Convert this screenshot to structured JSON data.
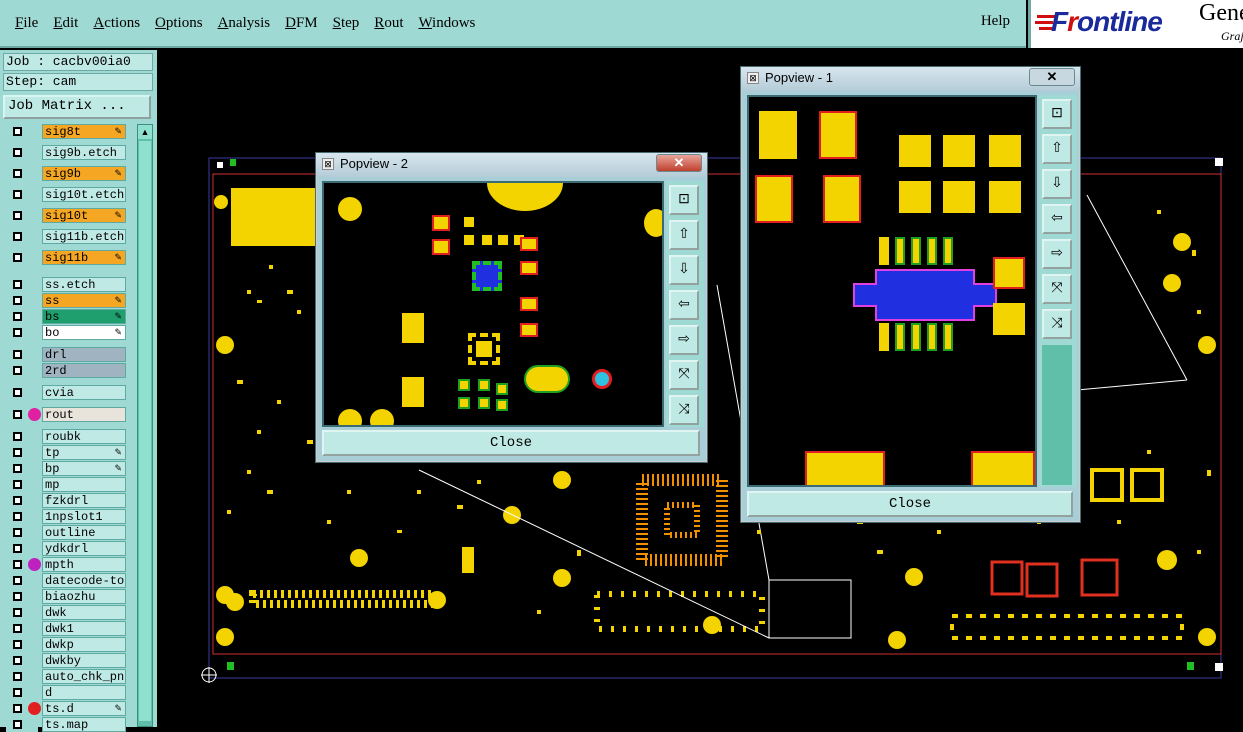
{
  "menu": {
    "items": [
      "File",
      "Edit",
      "Actions",
      "Options",
      "Analysis",
      "DFM",
      "Step",
      "Rout",
      "Windows"
    ],
    "help": "Help"
  },
  "logo": {
    "brand_a": "F",
    "brand_b": "r",
    "brand_c": "ontline",
    "sub": "Gene",
    "sub2": "Graj"
  },
  "info": {
    "job": "Job : cacbv00ia0",
    "step": "Step: cam",
    "job_matrix": "Job Matrix ..."
  },
  "layers": [
    {
      "name": "sig8t",
      "color": "#f5a623",
      "pen": true
    },
    {
      "name": "sig9b.etch",
      "color": "#bfe9e4",
      "pen": false
    },
    {
      "name": "sig9b",
      "color": "#f5a623",
      "pen": true
    },
    {
      "name": "sig10t.etch",
      "color": "#bfe9e4",
      "pen": false
    },
    {
      "name": "sig10t",
      "color": "#f5a623",
      "pen": true
    },
    {
      "name": "sig11b.etch",
      "color": "#bfe9e4",
      "pen": false
    },
    {
      "name": "sig11b",
      "color": "#f5a623",
      "pen": true
    },
    {
      "name": "ss.etch",
      "color": "#bfe9e4",
      "pen": false
    },
    {
      "name": "ss",
      "color": "#f5a623",
      "pen": true
    },
    {
      "name": "bs",
      "color": "#1f9e6e",
      "pen": true
    },
    {
      "name": "bo",
      "color": "#ffffff",
      "pen": true
    },
    {
      "name": "drl",
      "color": "#9fb4c0",
      "pen": false
    },
    {
      "name": "2rd",
      "color": "#9fb4c0",
      "pen": false
    },
    {
      "name": "cvia",
      "color": "#bfe9e4",
      "pen": false
    },
    {
      "name": "rout",
      "color": "#e8e4dc",
      "pen": false,
      "dot": "#e020a0"
    },
    {
      "name": "roubk",
      "color": "#bfe9e4",
      "pen": false
    },
    {
      "name": "tp",
      "color": "#bfe9e4",
      "pen": true
    },
    {
      "name": "bp",
      "color": "#bfe9e4",
      "pen": true
    },
    {
      "name": "mp",
      "color": "#bfe9e4",
      "pen": false
    },
    {
      "name": "fzkdrl",
      "color": "#bfe9e4",
      "pen": false
    },
    {
      "name": "1npslot1",
      "color": "#bfe9e4",
      "pen": false
    },
    {
      "name": "outline",
      "color": "#bfe9e4",
      "pen": false
    },
    {
      "name": "ydkdrl",
      "color": "#bfe9e4",
      "pen": false
    },
    {
      "name": "mpth",
      "color": "#bfe9e4",
      "pen": false,
      "dot": "#c020c0"
    },
    {
      "name": "datecode-to",
      "color": "#bfe9e4",
      "pen": false
    },
    {
      "name": "biaozhu",
      "color": "#bfe9e4",
      "pen": false
    },
    {
      "name": "dwk",
      "color": "#bfe9e4",
      "pen": false
    },
    {
      "name": "dwk1",
      "color": "#bfe9e4",
      "pen": false
    },
    {
      "name": "dwkp",
      "color": "#bfe9e4",
      "pen": false
    },
    {
      "name": "dwkby",
      "color": "#bfe9e4",
      "pen": false
    },
    {
      "name": "auto_chk_pn.",
      "color": "#bfe9e4",
      "pen": false
    },
    {
      "name": "d",
      "color": "#bfe9e4",
      "pen": false
    },
    {
      "name": "ts.d",
      "color": "#bfe9e4",
      "pen": true,
      "dot": "#e02020"
    },
    {
      "name": "ts.map",
      "color": "#bfe9e4",
      "pen": false
    }
  ],
  "popview2": {
    "title": "Popview - 2",
    "close": "Close",
    "x": "✕"
  },
  "popview1": {
    "title": "Popview - 1",
    "close": "Close",
    "x": "✕"
  }
}
